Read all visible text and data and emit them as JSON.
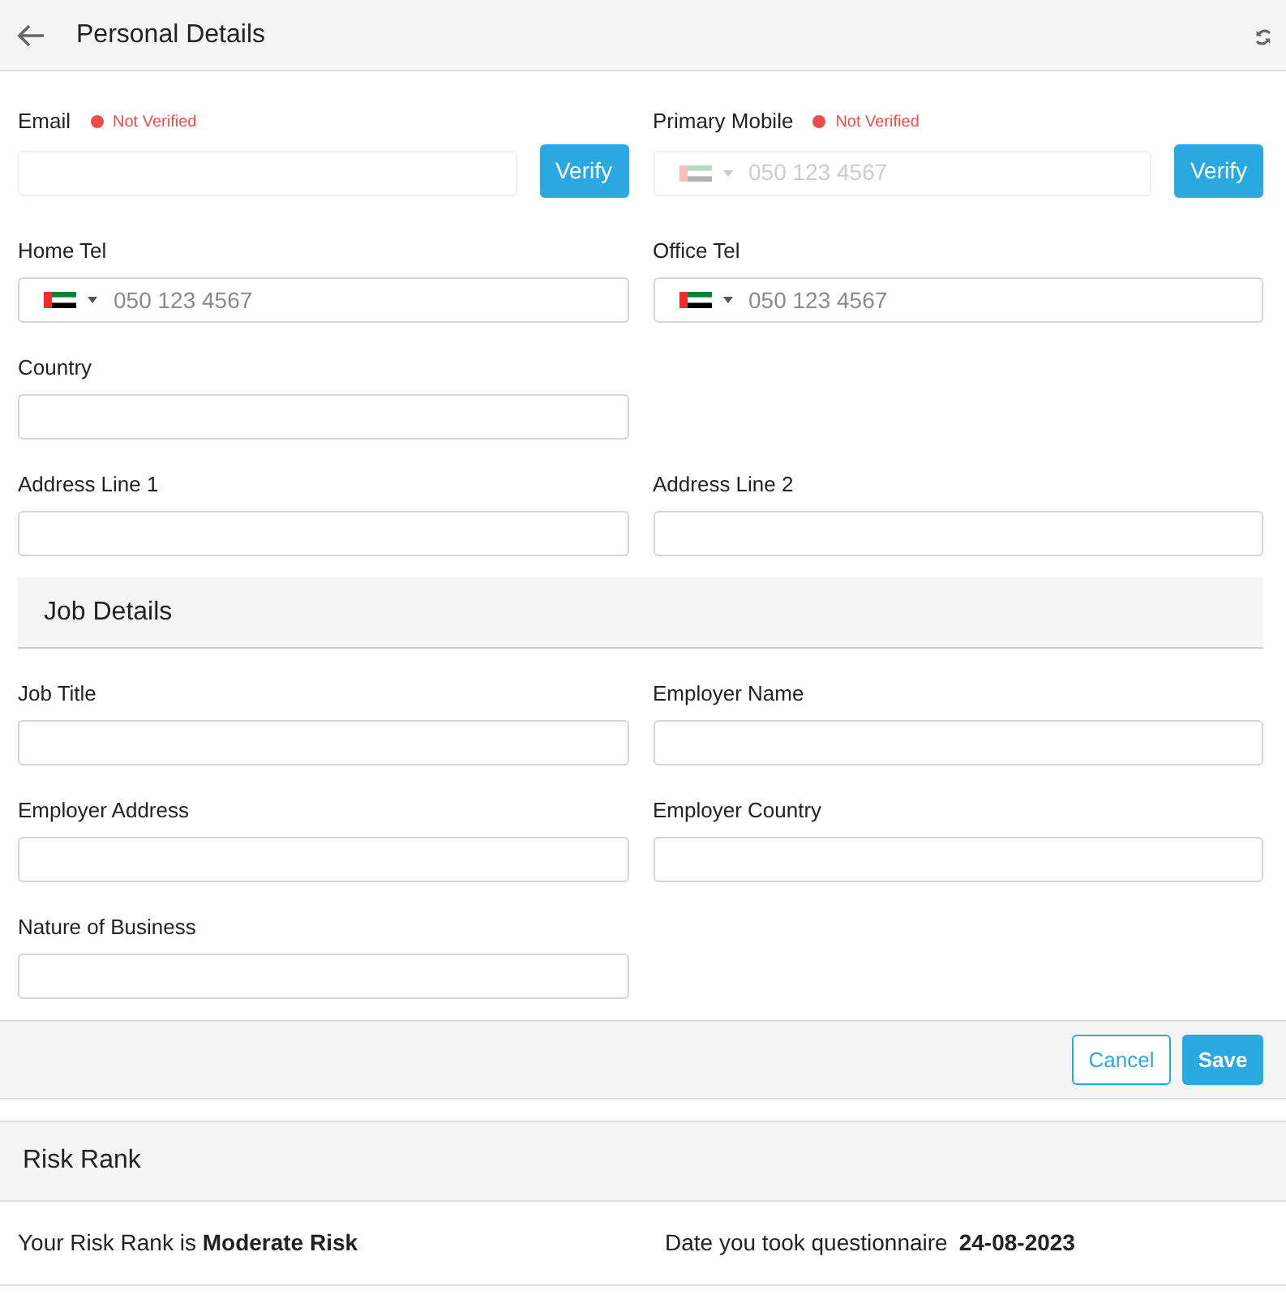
{
  "header": {
    "title": "Personal Details"
  },
  "personal_rows": [
    [
      {
        "kind": "verify",
        "label": "Email",
        "status": "Not Verified",
        "verified": false,
        "button": "Verify"
      },
      {
        "kind": "phone-verify",
        "label": "Primary Mobile",
        "status": "Not Verified",
        "verified": false,
        "button": "Verify",
        "disabled": true,
        "placeholder": "050 123 4567"
      }
    ],
    [
      {
        "kind": "phone",
        "label": "Home Tel",
        "placeholder": "050 123 4567"
      },
      {
        "kind": "phone",
        "label": "Office Tel",
        "placeholder": "050 123 4567"
      }
    ],
    [
      {
        "kind": "text",
        "label": "Country"
      }
    ],
    [
      {
        "kind": "text",
        "label": "Address Line 1"
      },
      {
        "kind": "text",
        "label": "Address Line 2"
      }
    ]
  ],
  "job_section": {
    "title": "Job Details",
    "rows": [
      [
        {
          "kind": "text",
          "label": "Job Title"
        },
        {
          "kind": "text",
          "label": "Employer Name"
        }
      ],
      [
        {
          "kind": "text",
          "label": "Employer Address"
        },
        {
          "kind": "text",
          "label": "Employer Country"
        }
      ],
      [
        {
          "kind": "text",
          "label": "Nature of Business"
        }
      ]
    ]
  },
  "actions": {
    "cancel": "Cancel",
    "save": "Save"
  },
  "risk": {
    "title": "Risk Rank",
    "rank_text": "Your Risk Rank is **Moderate Risk**",
    "date_label": "Date you took questionnaire",
    "date": "24-08-2023"
  }
}
